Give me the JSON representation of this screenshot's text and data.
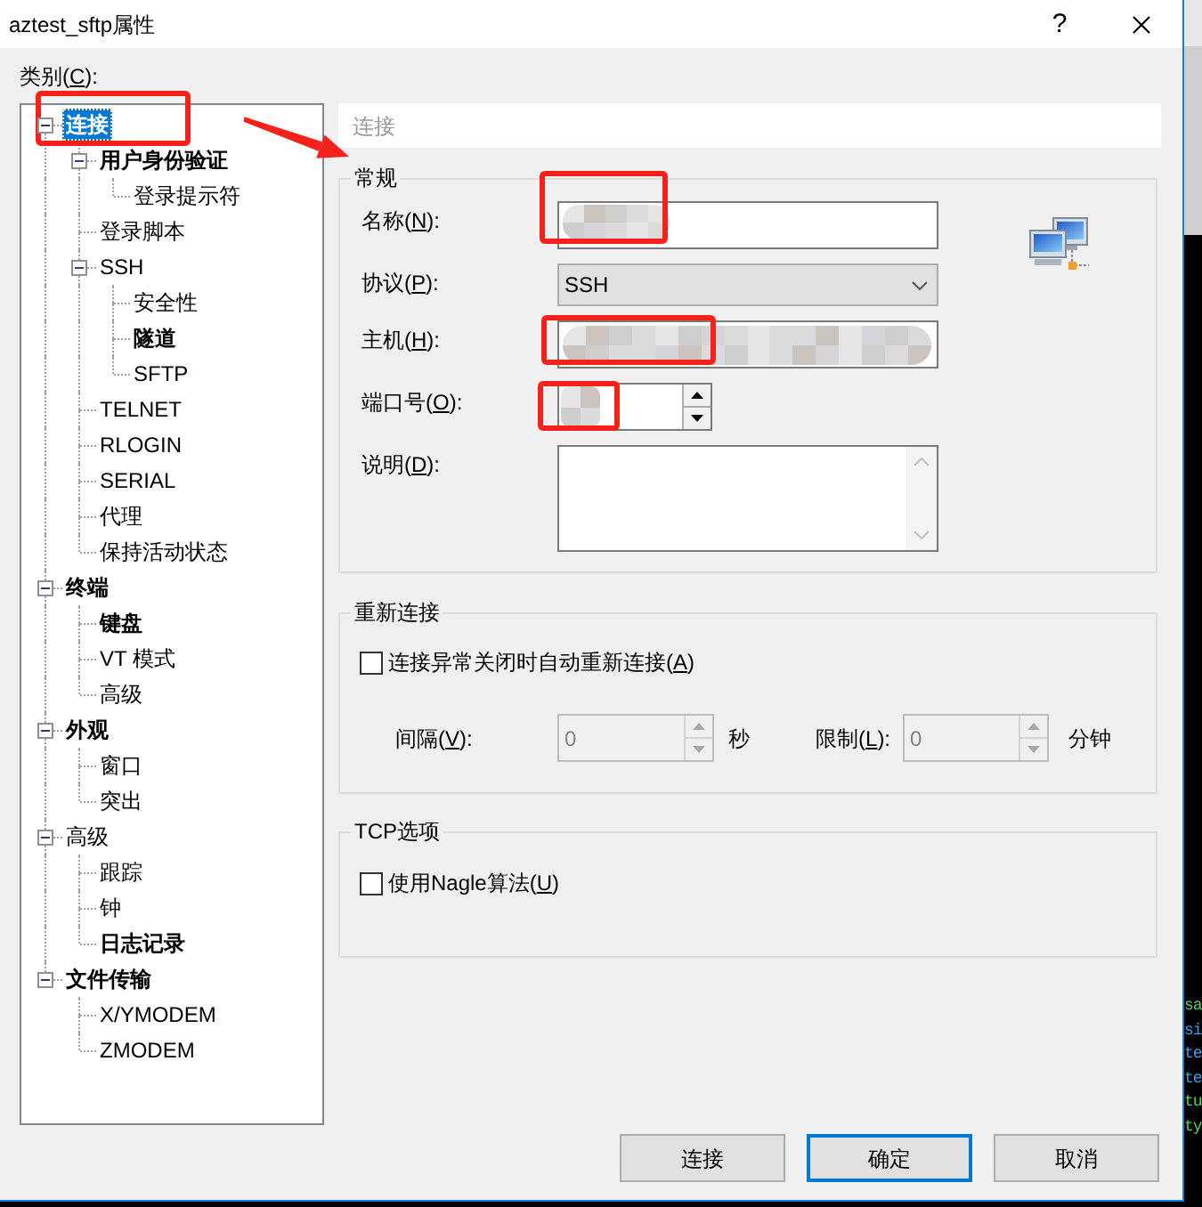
{
  "window": {
    "title": "aztest_sftp属性",
    "help_button": "?"
  },
  "category": {
    "label": {
      "before": "类别(",
      "key": "C",
      "after": "):"
    }
  },
  "tree": {
    "items": [
      {
        "label": "连接",
        "selected": true,
        "bold": true,
        "expanded": true,
        "children": [
          {
            "label": "用户身份验证",
            "selected": false,
            "bold": true,
            "expanded": true,
            "children": [
              {
                "label": "登录提示符",
                "selected": false,
                "bold": false
              }
            ]
          },
          {
            "label": "登录脚本",
            "selected": false,
            "bold": false
          },
          {
            "label": "SSH",
            "selected": false,
            "bold": false,
            "expanded": true,
            "children": [
              {
                "label": "安全性",
                "selected": false,
                "bold": false
              },
              {
                "label": "隧道",
                "selected": false,
                "bold": true
              },
              {
                "label": "SFTP",
                "selected": false,
                "bold": false
              }
            ]
          },
          {
            "label": "TELNET",
            "selected": false,
            "bold": false
          },
          {
            "label": "RLOGIN",
            "selected": false,
            "bold": false
          },
          {
            "label": "SERIAL",
            "selected": false,
            "bold": false
          },
          {
            "label": "代理",
            "selected": false,
            "bold": false
          },
          {
            "label": "保持活动状态",
            "selected": false,
            "bold": false
          }
        ]
      },
      {
        "label": "终端",
        "selected": false,
        "bold": true,
        "expanded": true,
        "children": [
          {
            "label": "键盘",
            "selected": false,
            "bold": true
          },
          {
            "label": "VT 模式",
            "selected": false,
            "bold": false
          },
          {
            "label": "高级",
            "selected": false,
            "bold": false
          }
        ]
      },
      {
        "label": "外观",
        "selected": false,
        "bold": true,
        "expanded": true,
        "children": [
          {
            "label": "窗口",
            "selected": false,
            "bold": false
          },
          {
            "label": "突出",
            "selected": false,
            "bold": false
          }
        ]
      },
      {
        "label": "高级",
        "selected": false,
        "bold": false,
        "expanded": true,
        "children": [
          {
            "label": "跟踪",
            "selected": false,
            "bold": false
          },
          {
            "label": "钟",
            "selected": false,
            "bold": false
          },
          {
            "label": "日志记录",
            "selected": false,
            "bold": true
          }
        ]
      },
      {
        "label": "文件传输",
        "selected": false,
        "bold": true,
        "expanded": true,
        "children": [
          {
            "label": "X/YMODEM",
            "selected": false,
            "bold": false
          },
          {
            "label": "ZMODEM",
            "selected": false,
            "bold": false
          }
        ]
      }
    ]
  },
  "panel": {
    "title": "连接",
    "general": {
      "title": "常规",
      "name": {
        "label": {
          "before": "名称(",
          "key": "N",
          "after": "):"
        },
        "redacted": true
      },
      "protocol": {
        "label": {
          "before": "协议(",
          "key": "P",
          "after": "):"
        },
        "value": "SSH"
      },
      "host": {
        "label": {
          "before": "主机(",
          "key": "H",
          "after": "):"
        },
        "redacted": true
      },
      "port": {
        "label": {
          "before": "端口号(",
          "key": "O",
          "after": "):"
        },
        "disabled": false,
        "redacted": true
      },
      "description": {
        "label": {
          "before": "说明(",
          "key": "D",
          "after": "):"
        }
      }
    },
    "reconnect": {
      "title": "重新连接",
      "auto_reconnect": {
        "label": {
          "before": "连接异常关闭时自动重新连接(",
          "key": "A",
          "after": ")"
        },
        "checked": false
      },
      "interval": {
        "label": {
          "before": "间隔(",
          "key": "V",
          "after": "):"
        },
        "value": "0",
        "unit": "秒",
        "disabled": true
      },
      "limit": {
        "label": {
          "before": "限制(",
          "key": "L",
          "after": "):"
        },
        "value": "0",
        "unit": "分钟",
        "disabled": true
      }
    },
    "tcp": {
      "title": "TCP选项",
      "nagle": {
        "label": {
          "before": "使用Nagle算法(",
          "key": "U",
          "after": ")"
        },
        "checked": false
      }
    }
  },
  "buttons": [
    {
      "label": "连接",
      "default": false
    },
    {
      "label": "确定",
      "default": true
    },
    {
      "label": "取消",
      "default": false
    }
  ],
  "annotations": [
    {
      "kind": "frame"
    },
    {
      "kind": "arrow"
    },
    {
      "kind": "frame"
    },
    {
      "kind": "frame"
    },
    {
      "kind": "frame"
    }
  ],
  "background_terminal": {
    "lines": [
      {
        "text": "sa",
        "color": "#55d055"
      },
      {
        "text": "si",
        "color": "#3c9ee6"
      },
      {
        "text": "te",
        "color": "#3c9ee6"
      },
      {
        "text": "te",
        "color": "#3c9ee6"
      },
      {
        "text": "tu",
        "color": "#55d055"
      },
      {
        "text": "ty",
        "color": "#55d055"
      }
    ]
  }
}
